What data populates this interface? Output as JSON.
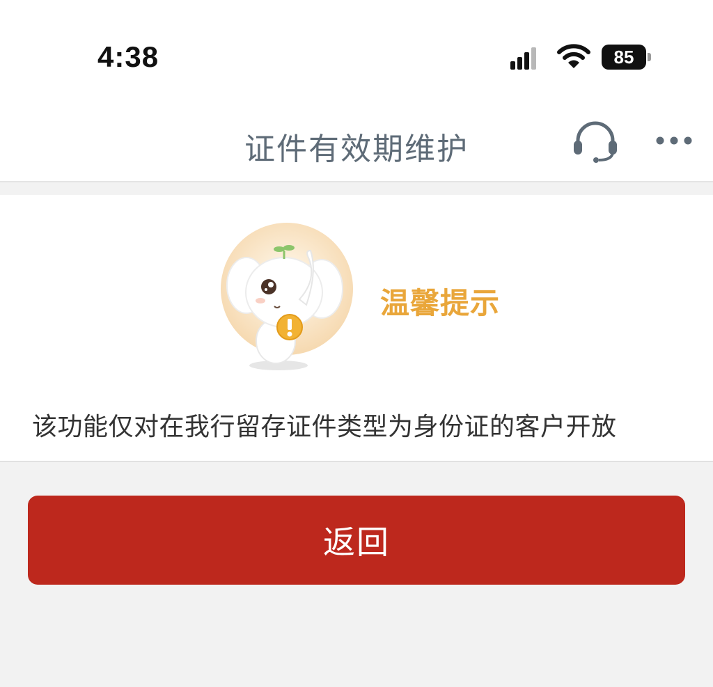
{
  "status_bar": {
    "time": "4:38",
    "battery_level": "85",
    "icons": [
      "signal-icon",
      "wifi-icon",
      "battery-icon"
    ]
  },
  "header": {
    "title": "证件有效期维护",
    "icons": [
      "headset-icon",
      "more-icon"
    ]
  },
  "notice": {
    "title": "温馨提示",
    "message": "该功能仅对在我行留存证件类型为身份证的客户开放",
    "title_color": "#e9a63a",
    "mascot": "elephant-mascot-icon"
  },
  "actions": {
    "back_label": "返回",
    "button_color": "#bd281d"
  }
}
